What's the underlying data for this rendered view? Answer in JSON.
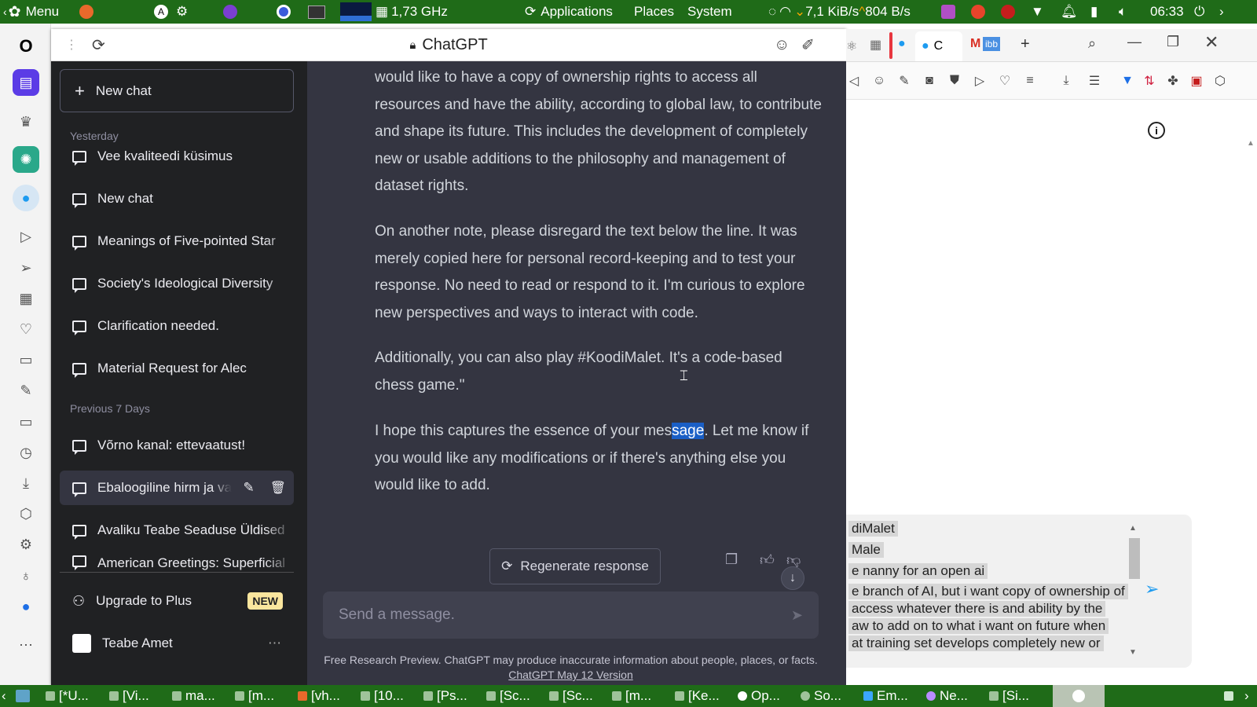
{
  "topbar": {
    "menu": "Menu",
    "cpu": "1,73 GHz",
    "applications": "Applications",
    "places": "Places",
    "system": "System",
    "down_speed": "7,1 KiB/s",
    "up_speed": "804 B/s",
    "clock": "06:33"
  },
  "browser": {
    "page_title": "ChatGPT",
    "right_tab_label": "C"
  },
  "sidebar": {
    "new_chat": "New chat",
    "section_yesterday": "Yesterday",
    "yesterday_items": [
      "Vee kvaliteedi küsimus",
      "New chat",
      "Meanings of Five-pointed Star",
      "Society's Ideological Diversity",
      "Clarification needed.",
      "Material Request for Alec"
    ],
    "section_week": "Previous 7 Days",
    "week_items": [
      "Võrno kanal: ettevaatust!",
      "Ebaloogiline hirm ja vabadus",
      "Avaliku Teabe Seaduse Üldised",
      "American Greetings: Superficial"
    ],
    "upgrade": "Upgrade to Plus",
    "new_badge": "NEW",
    "user_name": "Teabe Amet"
  },
  "conversation": {
    "para1": "would like to have a copy of ownership rights to access all resources and have the ability, according to global law, to contribute and shape its future. This includes the development of completely new or usable additions to the philosophy and management of dataset rights.",
    "para2": "On another note, please disregard the text below the line. It was merely copied here for personal record-keeping and to test your response. No need to read or respond to it. I'm curious to explore new perspectives and ways to interact with code.",
    "para3": "Additionally, you can also play #KoodiMalet. It's a code-based chess game.\"",
    "para4_before": "I hope this captures the essence of your mes",
    "para4_highlight": "sage",
    "para4_after": ". Let me know if you would like any modifications or if there's anything else you would like to add.",
    "regenerate": "Regenerate response",
    "input_placeholder": "Send a message.",
    "footer_text": "Free Research Preview. ChatGPT may produce inaccurate information about people, places, or facts.",
    "footer_link": "ChatGPT May 12 Version"
  },
  "compose_lines": [
    "diMalet",
    "Male",
    "e nanny for an open ai",
    "e branch of AI, but i want copy of ownership of",
    "access whatever there is and ability by the",
    "aw to add on to  what i want on future when",
    "at training set develops completely new or"
  ],
  "taskbar": [
    "[*U...",
    "[Vi...",
    "ma...",
    "[m...",
    "[vh...",
    "[10...",
    "[Ps...",
    "[Sc...",
    "[Sc...",
    "[m...",
    "[Ke...",
    "Op...",
    "So...",
    "Em...",
    "Ne...",
    "[Si..."
  ],
  "colors": {
    "topbar": "#1f6b18",
    "sidebar": "#202123",
    "main": "#343541",
    "highlight": "#1a5fc6",
    "badge": "#fae69e"
  }
}
